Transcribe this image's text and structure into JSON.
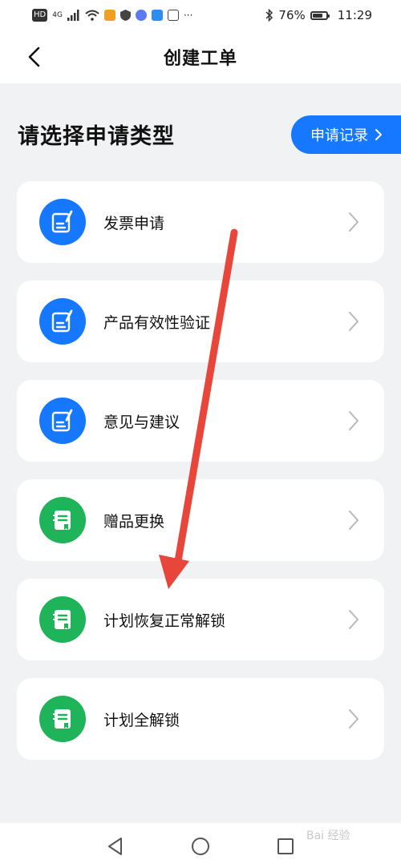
{
  "status_bar": {
    "left_icons": [
      "hd-icon",
      "signal-icon",
      "wifi-icon",
      "app-icon",
      "shield-icon",
      "music-icon",
      "cloud-icon",
      "hand-icon",
      "more-icon"
    ],
    "hd_label": "HD",
    "network_label": "4G",
    "more_label": "···",
    "battery_percent": "76%",
    "battery_level": 0.76,
    "time": "11:29"
  },
  "navbar": {
    "title": "创建工单",
    "back_icon": "chevron-left-icon"
  },
  "section": {
    "title": "请选择申请类型",
    "record_button_label": "申请记录",
    "record_button_icon": "chevron-right-icon"
  },
  "items": [
    {
      "label": "发票申请",
      "icon": "note-edit-icon",
      "color": "#1677ff"
    },
    {
      "label": "产品有效性验证",
      "icon": "note-edit-icon",
      "color": "#1677ff"
    },
    {
      "label": "意见与建议",
      "icon": "note-edit-icon",
      "color": "#1677ff"
    },
    {
      "label": "赠品更换",
      "icon": "notebook-icon",
      "color": "#1fb35a"
    },
    {
      "label": "计划恢复正常解锁",
      "icon": "notebook-icon",
      "color": "#1fb35a"
    },
    {
      "label": "计划全解锁",
      "icon": "notebook-icon",
      "color": "#1fb35a"
    }
  ],
  "bottom_nav": {
    "keys": [
      "back-triangle-icon",
      "home-circle-icon",
      "recents-square-icon"
    ]
  },
  "colors": {
    "accent": "#1677ff",
    "green": "#1fb35a",
    "background": "#f1f2f4",
    "annotation_arrow": "#e8463a"
  },
  "watermark": "Bai 经验"
}
